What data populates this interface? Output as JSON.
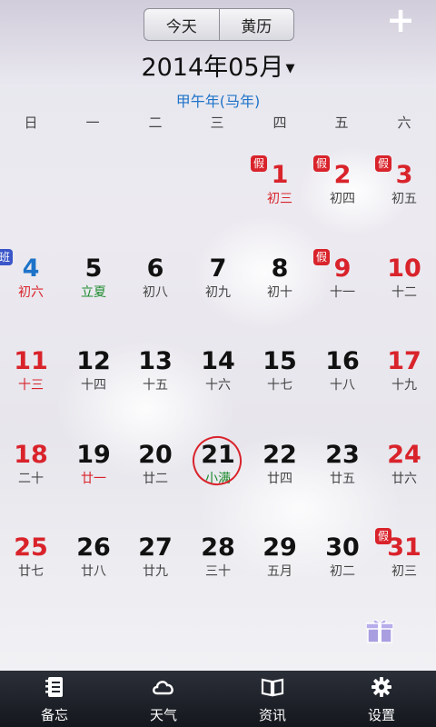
{
  "header": {
    "today_label": "今天",
    "almanac_label": "黄历",
    "add_label": "+",
    "month_title": "2014年05月",
    "dropdown_glyph": "▼",
    "ganzhi_year": "甲午年(马年)"
  },
  "weekdays": [
    "日",
    "一",
    "二",
    "三",
    "四",
    "五",
    "六"
  ],
  "days": [
    {
      "day": "1",
      "lunar": "初三",
      "badge": "假",
      "col": 4,
      "row": 0,
      "num_color": "#d9232b",
      "lunar_color": "#d9232b"
    },
    {
      "day": "2",
      "lunar": "初四",
      "badge": "假",
      "col": 5,
      "row": 0,
      "num_color": "#d9232b",
      "lunar_color": "#444444"
    },
    {
      "day": "3",
      "lunar": "初五",
      "badge": "假",
      "col": 6,
      "row": 0,
      "num_color": "#d9232b",
      "lunar_color": "#444444"
    },
    {
      "day": "4",
      "lunar": "初六",
      "badge": "班",
      "col": 0,
      "row": 1,
      "num_color": "#1e73c8",
      "lunar_color": "#d9232b"
    },
    {
      "day": "5",
      "lunar": "立夏",
      "col": 1,
      "row": 1,
      "num_color": "#111111",
      "lunar_color": "#1a8a2c"
    },
    {
      "day": "6",
      "lunar": "初八",
      "col": 2,
      "row": 1,
      "num_color": "#111111",
      "lunar_color": "#444444"
    },
    {
      "day": "7",
      "lunar": "初九",
      "col": 3,
      "row": 1,
      "num_color": "#111111",
      "lunar_color": "#444444"
    },
    {
      "day": "8",
      "lunar": "初十",
      "col": 4,
      "row": 1,
      "num_color": "#111111",
      "lunar_color": "#444444"
    },
    {
      "day": "9",
      "lunar": "十一",
      "badge": "假",
      "col": 5,
      "row": 1,
      "num_color": "#d9232b",
      "lunar_color": "#444444"
    },
    {
      "day": "10",
      "lunar": "十二",
      "col": 6,
      "row": 1,
      "num_color": "#d9232b",
      "lunar_color": "#444444"
    },
    {
      "day": "11",
      "lunar": "十三",
      "col": 0,
      "row": 2,
      "num_color": "#d9232b",
      "lunar_color": "#d9232b"
    },
    {
      "day": "12",
      "lunar": "十四",
      "col": 1,
      "row": 2,
      "num_color": "#111111",
      "lunar_color": "#444444"
    },
    {
      "day": "13",
      "lunar": "十五",
      "col": 2,
      "row": 2,
      "num_color": "#111111",
      "lunar_color": "#444444"
    },
    {
      "day": "14",
      "lunar": "十六",
      "col": 3,
      "row": 2,
      "num_color": "#111111",
      "lunar_color": "#444444"
    },
    {
      "day": "15",
      "lunar": "十七",
      "col": 4,
      "row": 2,
      "num_color": "#111111",
      "lunar_color": "#444444"
    },
    {
      "day": "16",
      "lunar": "十八",
      "col": 5,
      "row": 2,
      "num_color": "#111111",
      "lunar_color": "#444444"
    },
    {
      "day": "17",
      "lunar": "十九",
      "col": 6,
      "row": 2,
      "num_color": "#d9232b",
      "lunar_color": "#444444"
    },
    {
      "day": "18",
      "lunar": "二十",
      "col": 0,
      "row": 3,
      "num_color": "#d9232b",
      "lunar_color": "#444444"
    },
    {
      "day": "19",
      "lunar": "廿一",
      "col": 1,
      "row": 3,
      "num_color": "#111111",
      "lunar_color": "#d9232b"
    },
    {
      "day": "20",
      "lunar": "廿二",
      "col": 2,
      "row": 3,
      "num_color": "#111111",
      "lunar_color": "#444444"
    },
    {
      "day": "21",
      "lunar": "小满",
      "col": 3,
      "row": 3,
      "num_color": "#111111",
      "lunar_color": "#1a8a2c",
      "today": true
    },
    {
      "day": "22",
      "lunar": "廿四",
      "col": 4,
      "row": 3,
      "num_color": "#111111",
      "lunar_color": "#444444"
    },
    {
      "day": "23",
      "lunar": "廿五",
      "col": 5,
      "row": 3,
      "num_color": "#111111",
      "lunar_color": "#444444"
    },
    {
      "day": "24",
      "lunar": "廿六",
      "col": 6,
      "row": 3,
      "num_color": "#d9232b",
      "lunar_color": "#444444"
    },
    {
      "day": "25",
      "lunar": "廿七",
      "col": 0,
      "row": 4,
      "num_color": "#d9232b",
      "lunar_color": "#444444"
    },
    {
      "day": "26",
      "lunar": "廿八",
      "col": 1,
      "row": 4,
      "num_color": "#111111",
      "lunar_color": "#444444"
    },
    {
      "day": "27",
      "lunar": "廿九",
      "col": 2,
      "row": 4,
      "num_color": "#111111",
      "lunar_color": "#444444"
    },
    {
      "day": "28",
      "lunar": "三十",
      "col": 3,
      "row": 4,
      "num_color": "#111111",
      "lunar_color": "#444444"
    },
    {
      "day": "29",
      "lunar": "五月",
      "col": 4,
      "row": 4,
      "num_color": "#111111",
      "lunar_color": "#444444"
    },
    {
      "day": "30",
      "lunar": "初二",
      "col": 5,
      "row": 4,
      "num_color": "#111111",
      "lunar_color": "#444444"
    },
    {
      "day": "31",
      "lunar": "初三",
      "badge": "假",
      "col": 6,
      "row": 4,
      "num_color": "#d9232b",
      "lunar_color": "#444444"
    }
  ],
  "badge_colors": {
    "假": "#d9232b",
    "班": "#3a56c8"
  },
  "tabs": [
    {
      "label": "备忘",
      "icon": "notebook-icon"
    },
    {
      "label": "天气",
      "icon": "cloud-icon"
    },
    {
      "label": "资讯",
      "icon": "book-icon"
    },
    {
      "label": "设置",
      "icon": "gear-icon"
    }
  ],
  "gift_icon": "gift-icon"
}
